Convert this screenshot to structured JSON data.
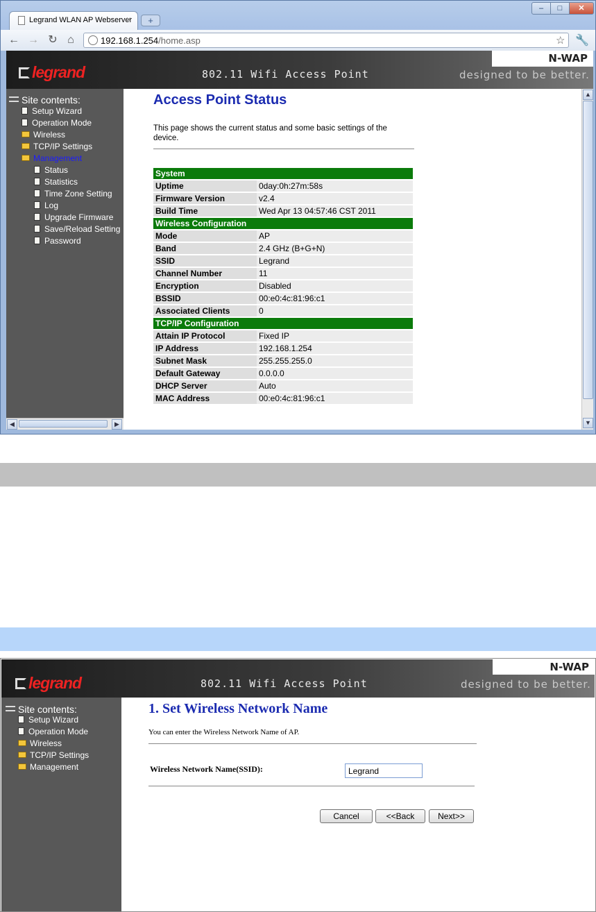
{
  "browser": {
    "tab_title": "Legrand WLAN AP Webserver",
    "tab_close": "×",
    "new_tab": "+",
    "url_host": "192.168.1.254",
    "url_path": "/home.asp",
    "win_min": "–",
    "win_max": "□",
    "win_close": "✕"
  },
  "header": {
    "logo": "legrand",
    "product": "802.11 Wifi Access Point",
    "model": "N-WAP",
    "tagline": "designed to be better."
  },
  "sidebar_status": {
    "heading": "Site contents:",
    "items": [
      {
        "label": "Setup Wizard",
        "icon": "document-icon"
      },
      {
        "label": "Operation Mode",
        "icon": "document-icon"
      },
      {
        "label": "Wireless",
        "icon": "folder-icon"
      },
      {
        "label": "TCP/IP Settings",
        "icon": "folder-icon"
      },
      {
        "label": "Management",
        "icon": "folder-open-icon"
      }
    ],
    "sub_items": [
      "Status",
      "Statistics",
      "Time Zone Setting",
      "Log",
      "Upgrade Firmware",
      "Save/Reload Setting",
      "Password"
    ]
  },
  "status_page": {
    "title": "Access Point Status",
    "description": "This page shows the current status and some basic settings of the device.",
    "sections": [
      {
        "title": "System",
        "rows": [
          [
            "Uptime",
            "0day:0h:27m:58s"
          ],
          [
            "Firmware Version",
            "v2.4"
          ],
          [
            "Build Time",
            "Wed Apr 13 04:57:46 CST 2011"
          ]
        ]
      },
      {
        "title": "Wireless Configuration",
        "rows": [
          [
            "Mode",
            "AP"
          ],
          [
            "Band",
            "2.4 GHz (B+G+N)"
          ],
          [
            "SSID",
            "Legrand"
          ],
          [
            "Channel Number",
            "11"
          ],
          [
            "Encryption",
            "Disabled"
          ],
          [
            "BSSID",
            "00:e0:4c:81:96:c1"
          ],
          [
            "Associated Clients",
            "0"
          ]
        ]
      },
      {
        "title": "TCP/IP Configuration",
        "rows": [
          [
            "Attain IP Protocol",
            "Fixed IP"
          ],
          [
            "IP Address",
            "192.168.1.254"
          ],
          [
            "Subnet Mask",
            "255.255.255.0"
          ],
          [
            "Default Gateway",
            "0.0.0.0"
          ],
          [
            "DHCP Server",
            "Auto"
          ],
          [
            "MAC Address",
            "00:e0:4c:81:96:c1"
          ]
        ]
      }
    ]
  },
  "sidebar_wizard": {
    "heading": "Site contents:",
    "items": [
      {
        "label": "Setup Wizard",
        "icon": "document-icon"
      },
      {
        "label": "Operation Mode",
        "icon": "document-icon"
      },
      {
        "label": "Wireless",
        "icon": "folder-icon"
      },
      {
        "label": "TCP/IP Settings",
        "icon": "folder-icon"
      },
      {
        "label": "Management",
        "icon": "folder-icon"
      }
    ]
  },
  "wizard": {
    "title": "1. Set Wireless Network Name",
    "description": "You can enter the Wireless Network Name of AP.",
    "field_label": "Wireless Network Name(SSID):",
    "field_value": "Legrand",
    "cancel_label": "Cancel",
    "back_label": "<<Back",
    "next_label": "Next>>"
  },
  "colors": {
    "section_green": "#0b7b0b",
    "title_blue": "#1b2bb0",
    "sidebar_gray": "#585858",
    "logo_red": "#e22222",
    "band_gray": "#c0c0c0",
    "band_blue": "#b7d6fa"
  }
}
